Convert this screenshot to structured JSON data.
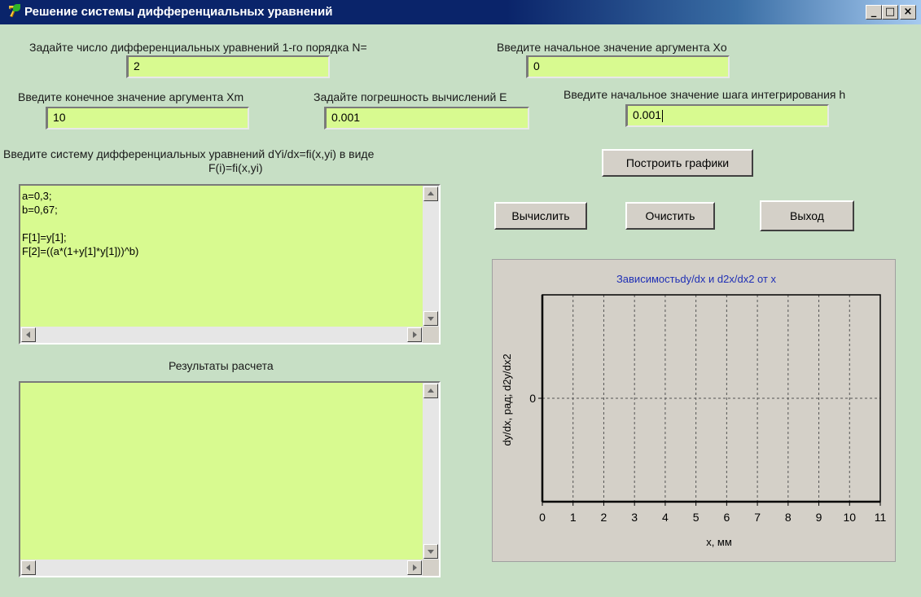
{
  "window": {
    "title": "Решение системы дифференциальных уравнений",
    "icon_glyph": "7",
    "caption_buttons": {
      "minimize": "_",
      "maximize": "□",
      "close": "×"
    }
  },
  "inputs": {
    "n_label": "Задайте число дифференциальных уравнений 1-го порядка N=",
    "n_value": "2",
    "x0_label": "Введите начальное значение аргумента Xo",
    "x0_value": "0",
    "xm_label": "Введите конечное значение аргумента Xm",
    "xm_value": "10",
    "eps_label": "Задайте погрешность вычислений E",
    "eps_value": "0.001",
    "h_label": "Введите начальное значение шага интегрирования  h",
    "h_value": "0.001"
  },
  "system": {
    "label_line1": "Введите систему дифференциальных уравнений dYi/dx=fi(x,yi) в виде",
    "label_line2": "F(i)=fi(x,yi)",
    "equations_text": "a=0,3;\nb=0,67;\n\nF[1]=y[1];\nF[2]=((a*(1+y[1]*y[1]))^b)"
  },
  "results": {
    "label": "Результаты расчета",
    "text": ""
  },
  "buttons": {
    "plot": "Построить графики",
    "compute": "Вычислить",
    "clear": "Очистить",
    "exit": "Выход"
  },
  "chart_data": {
    "type": "line",
    "title": "Зависимостьdy/dx и d2x/dx2 от x",
    "xlabel": "x, мм",
    "ylabel": "dy/dx, рад; d2y/dx2",
    "xlim": [
      0,
      11
    ],
    "x_ticks": [
      "0",
      "1",
      "2",
      "3",
      "4",
      "5",
      "6",
      "7",
      "8",
      "9",
      "10",
      "11"
    ],
    "y_ticks": [
      "0"
    ],
    "grid": true,
    "series": [],
    "title_color": "#1f2fb5"
  }
}
